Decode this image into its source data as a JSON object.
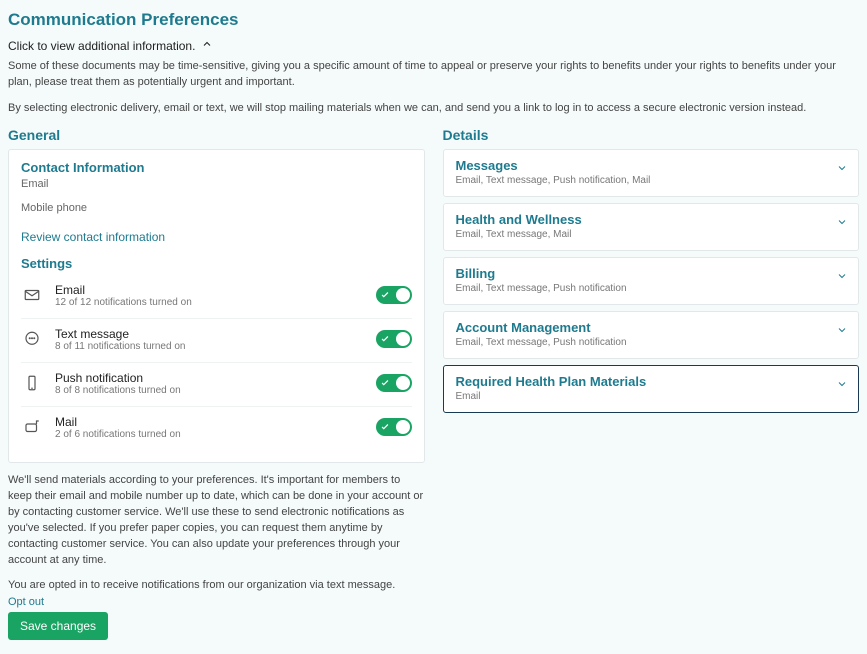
{
  "title": "Communication Preferences",
  "disclosure_label": "Click to view additional information.",
  "intro_p1": "Some of these documents may be time-sensitive, giving you a specific amount of time to appeal or preserve your rights to benefits under your rights to benefits under your plan, please treat them as potentially urgent and important.",
  "intro_p2": "By selecting electronic delivery, email or text, we will stop mailing materials when we can, and send you a link to log in to access a secure electronic version instead.",
  "general": {
    "heading": "General",
    "contact_heading": "Contact Information",
    "contact_email_label": "Email",
    "contact_phone_label": "Mobile phone",
    "review_link": "Review contact information",
    "settings_heading": "Settings",
    "settings": [
      {
        "name": "Email",
        "sub": "12 of 12 notifications turned on"
      },
      {
        "name": "Text message",
        "sub": "8 of 11 notifications turned on"
      },
      {
        "name": "Push notification",
        "sub": "8 of 8 notifications turned on"
      },
      {
        "name": "Mail",
        "sub": "2 of 6 notifications turned on"
      }
    ]
  },
  "details": {
    "heading": "Details",
    "items": [
      {
        "title": "Messages",
        "sub": "Email, Text message, Push notification, Mail"
      },
      {
        "title": "Health and Wellness",
        "sub": "Email, Text message, Mail"
      },
      {
        "title": "Billing",
        "sub": "Email, Text message, Push notification"
      },
      {
        "title": "Account Management",
        "sub": "Email, Text message, Push notification"
      },
      {
        "title": "Required Health Plan Materials",
        "sub": "Email"
      }
    ]
  },
  "footer_p1": "We'll send materials according to your preferences. It's important for members to keep their email and mobile number up to date, which can be done in your account or by contacting customer service. We'll use these to send electronic notifications as you've selected. If you prefer paper copies, you can request them anytime by contacting customer service. You can also update your preferences through your account at any time.",
  "footer_p2": "You are opted in to receive notifications from our organization via text message.",
  "optout_label": "Opt out",
  "save_label": "Save changes"
}
